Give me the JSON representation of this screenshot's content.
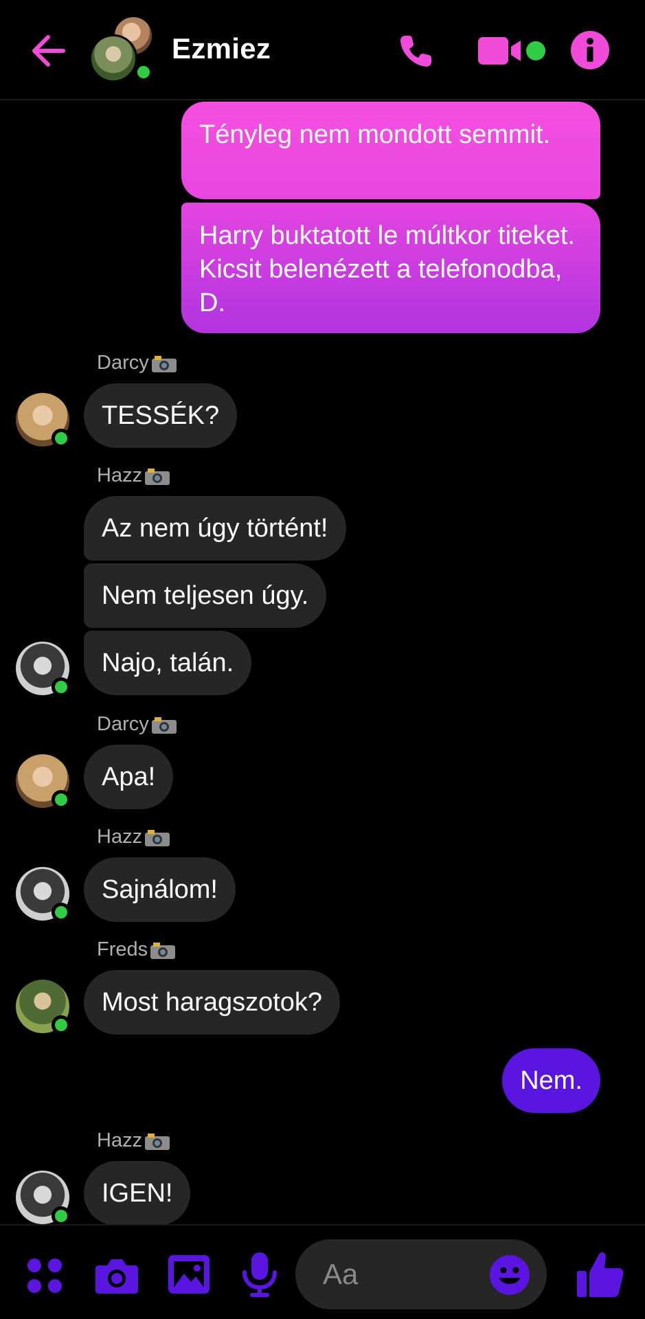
{
  "header": {
    "title": "Ezmiez",
    "icons": {
      "back": "arrow-left-icon",
      "call": "phone-icon",
      "video": "video-camera-icon",
      "info": "info-icon"
    },
    "accent_color": "#f24bd9"
  },
  "messages": [
    {
      "type": "outgoing",
      "text": "Tényleg nem mondott semmit."
    },
    {
      "type": "outgoing",
      "text": "Harry buktatott le múltkor titeket. Kicsit belenézett a telefonodba, D."
    },
    {
      "type": "sender",
      "name": "Darcy"
    },
    {
      "type": "incoming",
      "text": "TESSÉK?"
    },
    {
      "type": "sender",
      "name": "Hazz"
    },
    {
      "type": "incoming",
      "text": "Az nem úgy történt!"
    },
    {
      "type": "incoming",
      "text": "Nem teljesen úgy."
    },
    {
      "type": "incoming",
      "text": "Najo, talán."
    },
    {
      "type": "sender",
      "name": "Darcy"
    },
    {
      "type": "incoming",
      "text": "Apa!"
    },
    {
      "type": "sender",
      "name": "Hazz"
    },
    {
      "type": "incoming",
      "text": "Sajnálom!"
    },
    {
      "type": "sender",
      "name": "Freds"
    },
    {
      "type": "incoming",
      "text": "Most haragszotok?"
    },
    {
      "type": "outgoing",
      "text": "Nem."
    },
    {
      "type": "sender",
      "name": "Hazz"
    },
    {
      "type": "incoming",
      "text": "IGEN!"
    }
  ],
  "composer": {
    "placeholder": "Aa",
    "icons": {
      "apps": "four-dots-icon",
      "camera": "camera-icon",
      "gallery": "image-icon",
      "mic": "microphone-icon",
      "emoji": "emoji-icon",
      "like": "thumbs-up-icon"
    },
    "accent_color": "#5a16e0"
  },
  "colors": {
    "outgoing_gradient_top": "#f54fe0",
    "outgoing_gradient_bottom": "#a62ee0",
    "outgoing_violet": "#5a16e0",
    "incoming_bubble": "#262626",
    "online": "#31cc46"
  }
}
